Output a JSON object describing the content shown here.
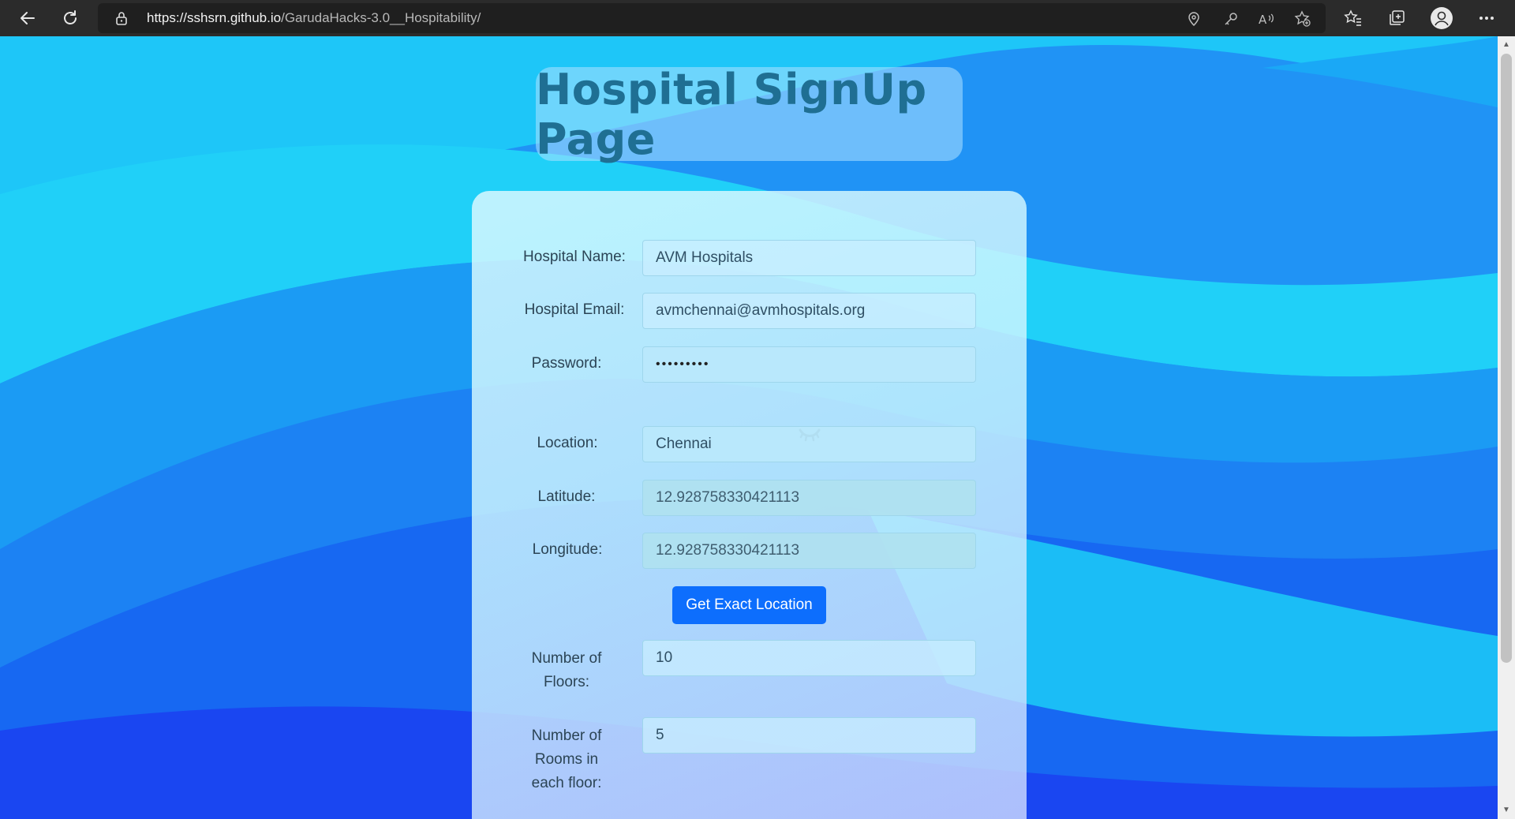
{
  "browser": {
    "url_host": "https://sshsrn.github.io",
    "url_path": "/GarudaHacks-3.0__Hospitability/"
  },
  "page": {
    "title": "Hospital SignUp Page"
  },
  "form": {
    "hospital_name_label": "Hospital Name:",
    "hospital_name_value": "AVM Hospitals",
    "hospital_email_label": "Hospital Email:",
    "hospital_email_value": "avmchennai@avmhospitals.org",
    "password_label": "Password:",
    "password_value": "•••••••••",
    "location_label": "Location:",
    "location_value": "Chennai",
    "latitude_label": "Latitude:",
    "latitude_value": "12.928758330421113",
    "longitude_label": "Longitude:",
    "longitude_value": "12.928758330421113",
    "get_location_button": "Get Exact Location",
    "floors_label": "Number of Floors:",
    "floors_value": "10",
    "rooms_label": "Number of Rooms in each floor:",
    "rooms_value": "5"
  },
  "icons": {
    "eye": "eye-closed-icon"
  }
}
